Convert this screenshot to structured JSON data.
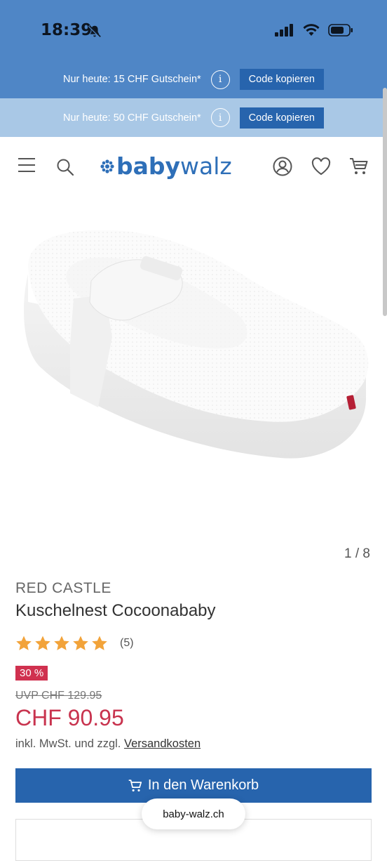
{
  "status": {
    "time": "18:39"
  },
  "promos": [
    {
      "text": "Nur heute: 15 CHF Gutschein*",
      "info": "i",
      "button": "Code kopieren"
    },
    {
      "text": "Nur heute: 50 CHF Gutschein*",
      "info": "i",
      "button": "Code kopieren"
    }
  ],
  "header": {
    "logo_baby": "baby",
    "logo_walz": "walz"
  },
  "gallery": {
    "counter": "1 / 8"
  },
  "product": {
    "brand": "RED CASTLE",
    "title": "Kuschelnest Cocoonababy",
    "rating": 5,
    "rating_count": "(5)",
    "discount": "30 %",
    "uvp": "UVP CHF 129.95",
    "price": "CHF 90.95",
    "tax_text": "inkl. MwSt. und zzgl. ",
    "shipping_link": "Versandkosten",
    "cart_button": "In den Warenkorb"
  },
  "browser": {
    "url": "baby-walz.ch"
  },
  "colors": {
    "brand_blue": "#2764ad",
    "promo_blue": "#4f86c6",
    "promo_light": "#a9c8e6",
    "price_red": "#c8334e",
    "star": "#f2a33a"
  }
}
